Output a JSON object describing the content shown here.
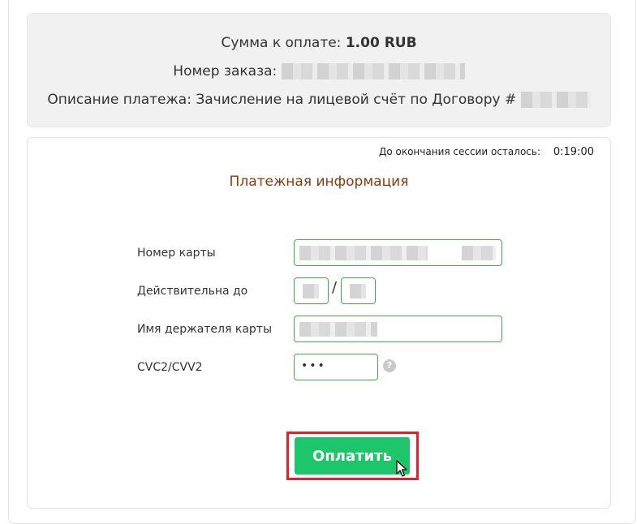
{
  "summary": {
    "amount_label": "Сумма к оплате:",
    "amount_value": "1.00 RUB",
    "order_label": "Номер заказа:",
    "description_label": "Описание платежа:",
    "description_value": "Зачисление на лицевой счёт по Договору #"
  },
  "session": {
    "label": "До окончания сессии осталось:",
    "time": "0:19:00"
  },
  "form": {
    "title": "Платежная информация",
    "card_number_label": "Номер карты",
    "expiry_label": "Действительна до",
    "expiry_separator": "/",
    "holder_label": "Имя держателя карты",
    "cvc_label": "CVC2/CVV2",
    "cvc_value": "•••",
    "help_glyph": "?",
    "pay_button": "Оплатить"
  },
  "colors": {
    "accent_green": "#1dc56b",
    "input_border": "#3fae4a",
    "highlight": "#e4202a",
    "title": "#8b3a0e"
  },
  "icons": [
    "question-circle-icon",
    "mouse-cursor-icon"
  ]
}
